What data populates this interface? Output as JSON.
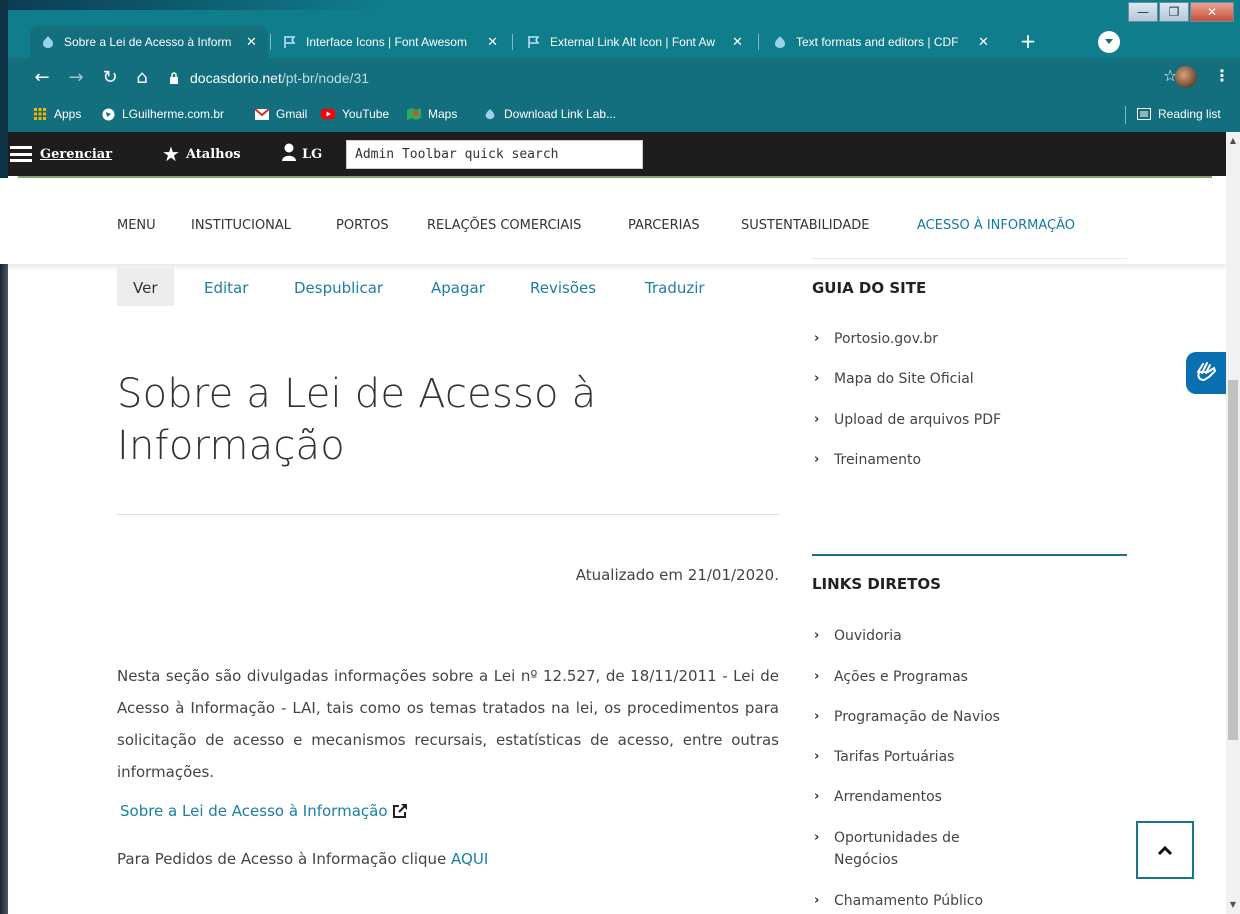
{
  "browser": {
    "tabs": [
      {
        "title": "Sobre a Lei de Acesso à Inform",
        "active": true,
        "icon": "drupal-icon"
      },
      {
        "title": "Interface Icons | Font Awesom",
        "active": false,
        "icon": "flag-icon"
      },
      {
        "title": "External Link Alt Icon | Font Aw",
        "active": false,
        "icon": "flag-icon"
      },
      {
        "title": "Text formats and editors | CDF",
        "active": false,
        "icon": "drupal-icon"
      }
    ],
    "close_glyph": "✕",
    "new_tab": "+",
    "url_host": "docasdorio.net",
    "url_path": "/pt-br/node/31",
    "bookmarks": [
      "Apps",
      "LGuilherme.com.br",
      "Gmail",
      "YouTube",
      "Maps",
      "Download Link Lab..."
    ],
    "reading_list": "Reading list",
    "colors": {
      "chrome": "#136e7e",
      "tabstrip": "#0f7d8c"
    }
  },
  "admin_toolbar": {
    "manage": "Gerenciar",
    "shortcuts": "Atalhos",
    "user": "LG",
    "search_placeholder": "Admin Toolbar quick search"
  },
  "main_nav": [
    "MENU",
    "INSTITUCIONAL",
    "PORTOS",
    "RELAÇÕES COMERCIAIS",
    "PARCERIAS",
    "SUSTENTABILIDADE",
    "ACESSO À INFORMAÇÃO"
  ],
  "local_tasks": [
    "Ver",
    "Editar",
    "Despublicar",
    "Apagar",
    "Revisões",
    "Traduzir"
  ],
  "page": {
    "title_line1": "Sobre a Lei de Acesso à",
    "title_line2": "Informação",
    "updated": "Atualizado em 21/01/2020.",
    "body": "Nesta seção são divulgadas informações sobre a Lei nº 12.527, de 18/11/2011 - Lei de Acesso à Informação - LAI, tais como os temas tratados na lei, os procedimentos para solicitação de acesso e mecanismos recursais, estatísticas de acesso, entre outras informações.",
    "external_link": "Sobre a Lei de Acesso à Informação",
    "request_text": "Para Pedidos de Acesso à Informação clique",
    "request_link": "AQUI"
  },
  "sidebar": {
    "guide_heading": "GUIA DO SITE",
    "guide_links": [
      "Portosio.gov.br",
      "Mapa do Site Oficial",
      "Upload de arquivos PDF",
      "Treinamento"
    ],
    "direct_heading": "LINKS DIRETOS",
    "direct_links": [
      "Ouvidoria",
      "Ações e Programas",
      "Programação de Navios",
      "Tarifas Portuárias",
      "Arrendamentos",
      "Oportunidades de Negócios",
      "Chamamento Público"
    ],
    "accent_color": "#1a6f86",
    "link_color": "#1a7fa0"
  }
}
